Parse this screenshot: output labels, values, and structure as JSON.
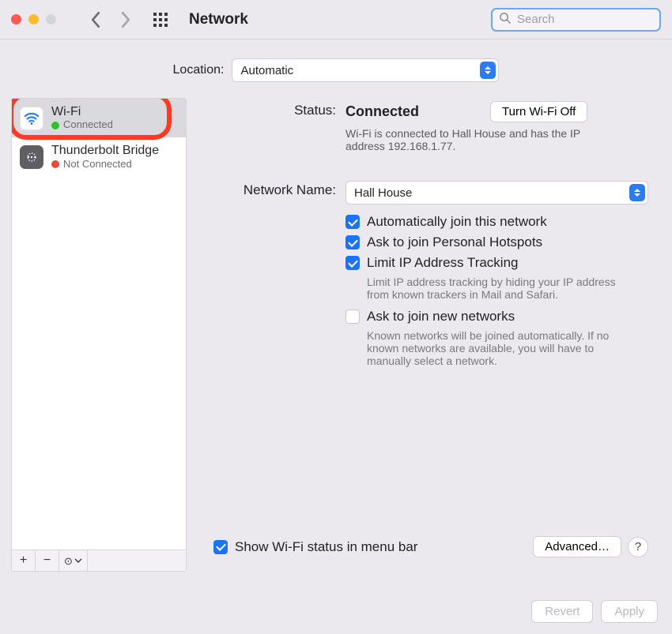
{
  "window": {
    "title": "Network",
    "search_placeholder": "Search"
  },
  "location": {
    "label": "Location:",
    "value": "Automatic"
  },
  "sidebar": {
    "items": [
      {
        "name": "Wi-Fi",
        "status": "Connected",
        "state": "green",
        "icon": "wifi",
        "selected": true,
        "highlighted": true
      },
      {
        "name": "Thunderbolt Bridge",
        "status": "Not Connected",
        "state": "red",
        "icon": "thunderbolt",
        "selected": false,
        "highlighted": false
      }
    ],
    "footer": {
      "add": "+",
      "remove": "−",
      "menu": "⊙"
    }
  },
  "detail": {
    "status_label": "Status:",
    "status_value": "Connected",
    "toggle_button": "Turn Wi-Fi Off",
    "status_desc": "Wi-Fi is connected to Hall House and has the IP address 192.168.1.77.",
    "network_label": "Network Name:",
    "network_value": "Hall House",
    "checkboxes": [
      {
        "label": "Automatically join this network",
        "checked": true,
        "sub": ""
      },
      {
        "label": "Ask to join Personal Hotspots",
        "checked": true,
        "sub": ""
      },
      {
        "label": "Limit IP Address Tracking",
        "checked": true,
        "sub": "Limit IP address tracking by hiding your IP address from known trackers in Mail and Safari."
      },
      {
        "label": "Ask to join new networks",
        "checked": false,
        "sub": "Known networks will be joined automatically. If no known networks are available, you will have to manually select a network."
      }
    ],
    "menubar_checkbox": {
      "label": "Show Wi-Fi status in menu bar",
      "checked": true
    },
    "advanced_button": "Advanced…",
    "help_button": "?"
  },
  "bottom": {
    "revert": "Revert",
    "apply": "Apply"
  }
}
